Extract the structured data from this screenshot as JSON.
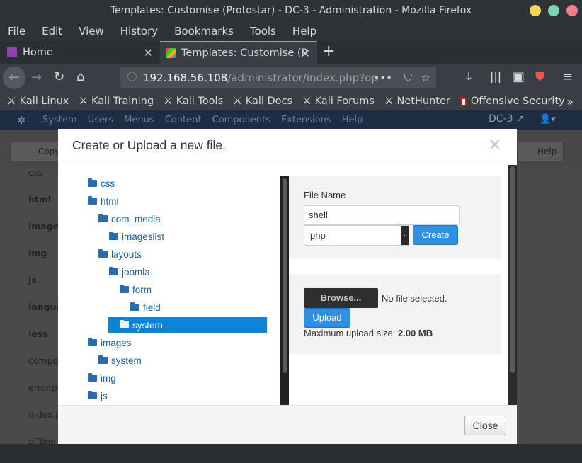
{
  "window": {
    "title": "Templates: Customise (Protostar) - DC-3 - Administration - Mozilla Firefox"
  },
  "menubar": [
    "File",
    "Edit",
    "View",
    "History",
    "Bookmarks",
    "Tools",
    "Help"
  ],
  "tabs": {
    "home": "Home",
    "active": "Templates: Customise (P"
  },
  "url": {
    "host": "192.168.56.108",
    "path": "/administrator/index.php?op"
  },
  "bookmarks": [
    "Kali Linux",
    "Kali Training",
    "Kali Tools",
    "Kali Docs",
    "Kali Forums",
    "NetHunter",
    "Offensive Security"
  ],
  "joomla": {
    "menus": [
      "System",
      "Users",
      "Menus",
      "Content",
      "Components",
      "Extensions",
      "Help"
    ],
    "site": "DC-3",
    "toolbar_copy": "Copy",
    "toolbar_help": "Help",
    "left_files": [
      "css",
      "html",
      "images",
      "img",
      "js",
      "langua",
      "less",
      "compo",
      "error.ph",
      "index.p",
      "offline"
    ]
  },
  "modal": {
    "title": "Create or Upload a new file.",
    "close_x": "×",
    "tree": [
      {
        "label": "css",
        "depth": 0
      },
      {
        "label": "html",
        "depth": 0
      },
      {
        "label": "com_media",
        "depth": 1
      },
      {
        "label": "imageslist",
        "depth": 2
      },
      {
        "label": "layouts",
        "depth": 1
      },
      {
        "label": "joomla",
        "depth": 2
      },
      {
        "label": "form",
        "depth": 3
      },
      {
        "label": "field",
        "depth": 4
      },
      {
        "label": "system",
        "depth": 3,
        "selected": true
      },
      {
        "label": "images",
        "depth": 0
      },
      {
        "label": "system",
        "depth": 1
      },
      {
        "label": "img",
        "depth": 0
      },
      {
        "label": "js",
        "depth": 0
      }
    ],
    "file_name_label": "File Name",
    "file_name_value": "shell",
    "extension": "php",
    "create_label": "Create",
    "browse_label": "Browse...",
    "no_file": "No file selected.",
    "upload_label": "Upload",
    "max_upload_label": "Maximum upload size: ",
    "max_upload_value": "2.00 MB",
    "close_label": "Close"
  },
  "colors": {
    "accent": "#2f8fe0",
    "selection": "#0a84d7",
    "tab_highlight": "#5ab4f5",
    "joomla_header": "#1c2d44"
  }
}
